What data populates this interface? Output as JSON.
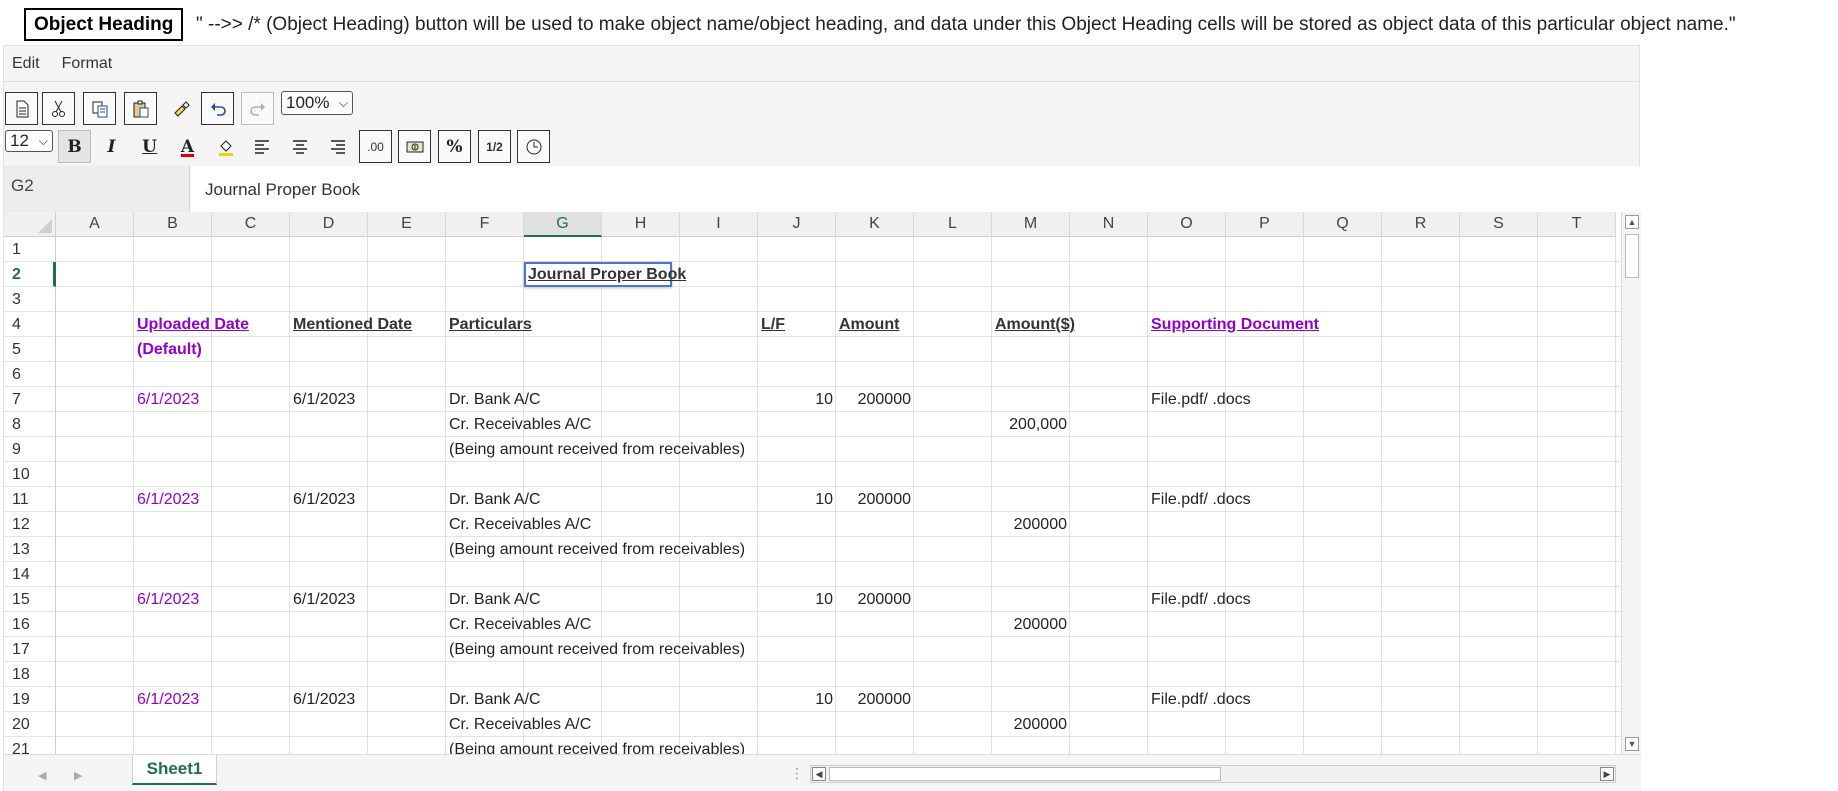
{
  "object_heading": {
    "button_label": "Object Heading",
    "note": "\" -->> /* (Object Heading) button will be used to make object name/object heading, and data under this Object Heading cells will be stored as object data of this particular object name.\""
  },
  "menu": {
    "items": [
      "Edit",
      "Format"
    ]
  },
  "toolbar": {
    "zoom": "100%",
    "font_size": "12",
    "bold": "B",
    "italic": "I",
    "underline": "U",
    "font_color": "A",
    "decimal": ".00",
    "percent": "%",
    "fraction": "1/2"
  },
  "name_box": "G2",
  "formula_value": "Journal Proper Book",
  "columns": [
    "A",
    "B",
    "C",
    "D",
    "E",
    "F",
    "G",
    "H",
    "I",
    "J",
    "K",
    "L",
    "M",
    "N",
    "O",
    "P",
    "Q",
    "R",
    "S",
    "T"
  ],
  "active_column": "G",
  "rows": [
    "1",
    "2",
    "3",
    "4",
    "5",
    "6",
    "7",
    "8",
    "9",
    "10",
    "11",
    "12",
    "13",
    "14",
    "15",
    "16",
    "17",
    "18",
    "19",
    "20",
    "21"
  ],
  "active_row": "2",
  "selected_cell_value": "Journal Proper Book",
  "headers": {
    "uploaded_date": "Uploaded Date",
    "default": "(Default)",
    "mentioned_date": "Mentioned Date",
    "particulars": "Particulars",
    "lf": "L/F",
    "amount": "Amount",
    "amount_usd": "Amount($)",
    "supporting_document": "Supporting Document"
  },
  "entries": [
    {
      "uploaded_date": "6/1/2023",
      "mentioned_date": "6/1/2023",
      "debit": "Dr. Bank A/C",
      "lf": "10",
      "amount": "200000",
      "document": "File.pdf/ .docs",
      "credit": "Cr. Receivables A/C",
      "credit_amount": "200,000",
      "narration": "(Being amount received from receivables)"
    },
    {
      "uploaded_date": "6/1/2023",
      "mentioned_date": "6/1/2023",
      "debit": "Dr. Bank A/C",
      "lf": "10",
      "amount": "200000",
      "document": "File.pdf/ .docs",
      "credit": "Cr. Receivables A/C",
      "credit_amount": "200000",
      "narration": "(Being amount received from receivables)"
    },
    {
      "uploaded_date": "6/1/2023",
      "mentioned_date": "6/1/2023",
      "debit": "Dr. Bank A/C",
      "lf": "10",
      "amount": "200000",
      "document": "File.pdf/ .docs",
      "credit": "Cr. Receivables A/C",
      "credit_amount": "200000",
      "narration": "(Being amount received from receivables)"
    },
    {
      "uploaded_date": "6/1/2023",
      "mentioned_date": "6/1/2023",
      "debit": "Dr. Bank A/C",
      "lf": "10",
      "amount": "200000",
      "document": "File.pdf/ .docs",
      "credit": "Cr. Receivables A/C",
      "credit_amount": "200000",
      "narration": "(Being amount received from receivables)"
    }
  ],
  "sheet_tab": "Sheet1",
  "colors": {
    "accent_green": "#1e7145",
    "link_purple": "#9400d3",
    "selection_blue": "#4a78c8"
  }
}
